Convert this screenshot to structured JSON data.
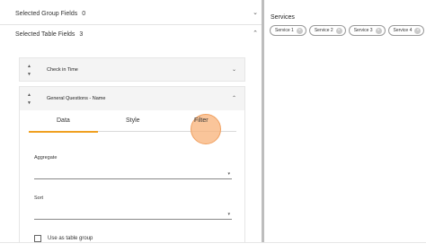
{
  "left": {
    "group_fields": {
      "label": "Selected Group Fields",
      "count": "0"
    },
    "table_fields": {
      "label": "Selected Table Fields",
      "count": "3"
    },
    "cards": [
      {
        "title": "Check in Time",
        "expanded": false
      },
      {
        "title": "General Questions - Name",
        "expanded": true
      }
    ],
    "tabs": [
      "Data",
      "Style",
      "Filter"
    ],
    "active_tab": "Data",
    "aggregate": {
      "label": "Aggregate",
      "value": ""
    },
    "sort": {
      "label": "Sort",
      "value": ""
    },
    "use_as_table_group": {
      "label": "Use as table group",
      "checked": false
    }
  },
  "right": {
    "title": "Services",
    "chips": [
      "Service 1",
      "Service 2",
      "Service 3",
      "Service 4"
    ]
  },
  "colors": {
    "accent": "#f0a020",
    "click_marker": "#f8b278"
  },
  "icons": [
    "chevron-down-icon",
    "chevron-up-icon",
    "sort-up-icon",
    "sort-down-icon",
    "close-icon"
  ]
}
